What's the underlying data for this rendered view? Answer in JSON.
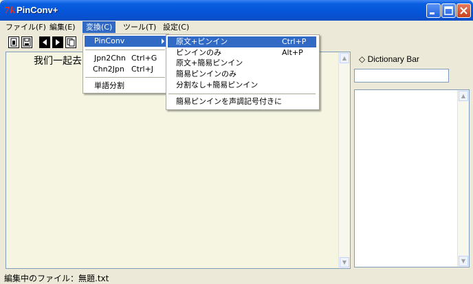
{
  "window": {
    "title": "PinConv+",
    "icon": "pinconv-app-icon"
  },
  "menubar": {
    "items": [
      "ファイル(F)",
      "編集(E)",
      "変換(C)",
      "ツール(T)",
      "設定(C)"
    ],
    "active": "変換(C)"
  },
  "editor": {
    "text": "我们一起去"
  },
  "dictionary": {
    "label": "◇ Dictionary Bar",
    "input_value": ""
  },
  "status": {
    "text": "編集中のファイル：無題.txt"
  },
  "convert_menu": {
    "items": [
      {
        "label": "PinConv",
        "shortcut": ""
      },
      {
        "label": "Jpn2Chn",
        "shortcut": "Ctrl+G"
      },
      {
        "label": "Chn2Jpn",
        "shortcut": "Ctrl+J"
      },
      {
        "label": "単語分割",
        "shortcut": ""
      }
    ]
  },
  "pinconv_submenu": {
    "items": [
      {
        "label": "原文+ピンイン",
        "shortcut": "Ctrl+P"
      },
      {
        "label": "ピンインのみ",
        "shortcut": "Alt+P"
      },
      {
        "label": "原文+簡易ピンイン",
        "shortcut": ""
      },
      {
        "label": "簡易ピンインのみ",
        "shortcut": ""
      },
      {
        "label": "分割なし+簡易ピンイン",
        "shortcut": ""
      },
      {
        "label": "簡易ピンインを声調記号付きに",
        "shortcut": ""
      }
    ]
  },
  "colors": {
    "titlebar": "#0554d8",
    "highlight": "#316ac5",
    "editor_bg": "#f5f5e1",
    "app_icon": "#e8321e"
  }
}
